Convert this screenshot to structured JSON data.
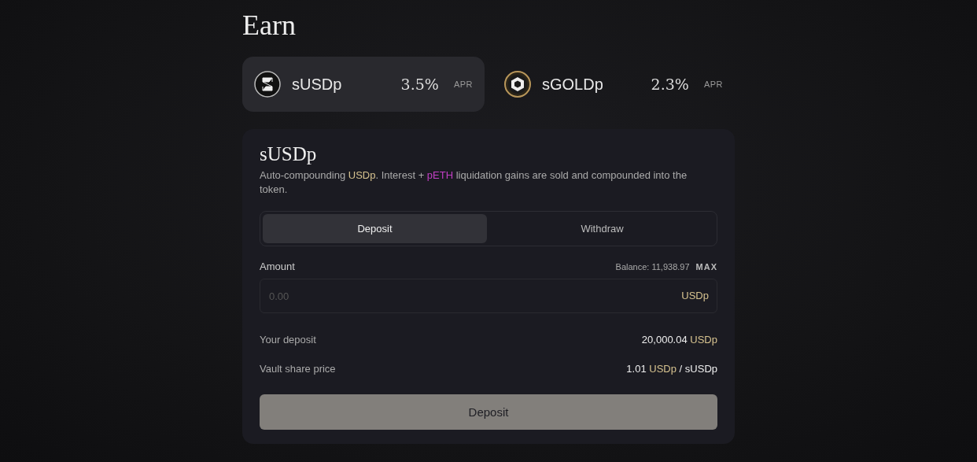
{
  "page": {
    "title": "Earn"
  },
  "vaults": [
    {
      "name": "sUSDp",
      "rate": "3.5%",
      "rate_unit": "APR",
      "selected": true,
      "kind": "dollar"
    },
    {
      "name": "sGOLDp",
      "rate": "2.3%",
      "rate_unit": "APR",
      "selected": false,
      "kind": "gold"
    }
  ],
  "card": {
    "title": "sUSDp",
    "description": [
      {
        "text": "Auto-compounding ",
        "kind": "plain"
      },
      {
        "text": "USDp",
        "kind": "token"
      },
      {
        "text": ". Interest + ",
        "kind": "plain"
      },
      {
        "text": "pETH",
        "kind": "accent"
      },
      {
        "text": " liquidation gains are sold and compounded into the token.",
        "kind": "plain"
      }
    ],
    "modes": [
      {
        "label": "Deposit",
        "selected": true
      },
      {
        "label": "Withdraw",
        "selected": false
      }
    ],
    "amount": {
      "label": "Amount",
      "balance": "Balance: 11,938.97",
      "max": "MAX",
      "placeholder": "0.00",
      "unit": "USDp"
    },
    "stats": [
      {
        "label": "Your deposit",
        "value": [
          {
            "text": "20,000.04",
            "kind": "plain"
          },
          {
            "text": "USDp",
            "kind": "token"
          }
        ]
      },
      {
        "label": "Vault share price",
        "value": [
          {
            "text": "1.01",
            "kind": "plain"
          },
          {
            "text": "USDp",
            "kind": "token"
          },
          {
            "text": "/ sUSDp",
            "kind": "plain"
          }
        ]
      }
    ],
    "submit": {
      "label": "Deposit",
      "disabled": true
    }
  }
}
